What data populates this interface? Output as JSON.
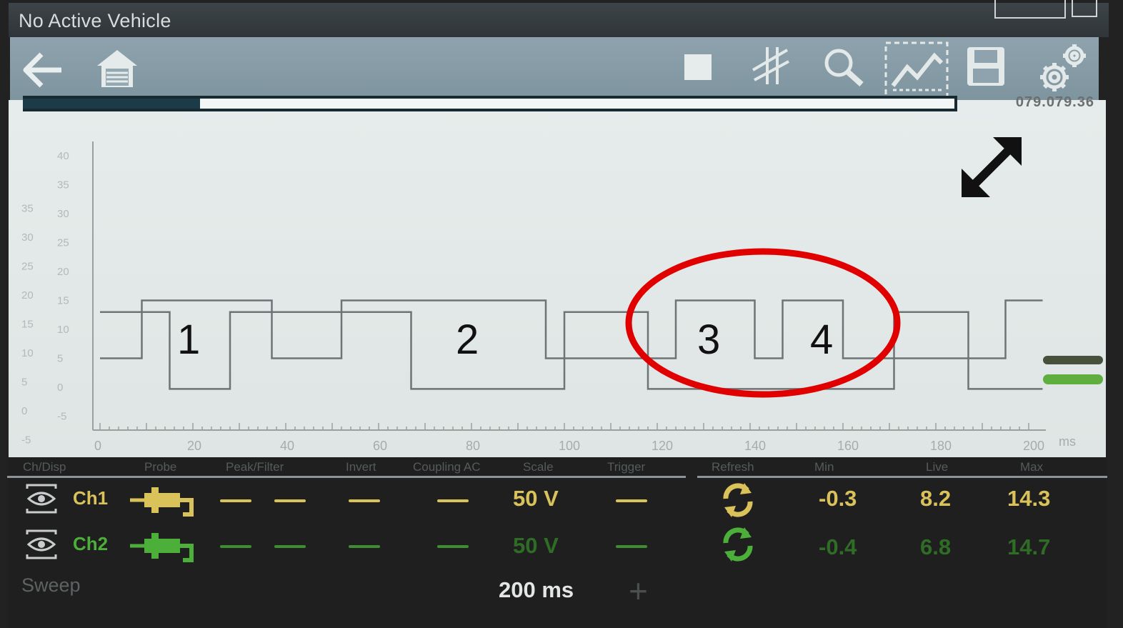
{
  "title_bar": {
    "title": "No Active Vehicle"
  },
  "toolbar": {
    "icons": [
      "back-arrow-icon",
      "home-garage-icon",
      "stop-icon",
      "cursor-icon",
      "zoom-icon",
      "trace-display-icon",
      "save-icon",
      "settings-gear-icon"
    ]
  },
  "capture": {
    "buffer_progress": 0.19,
    "readout": "079.079.36"
  },
  "chart_data": {
    "type": "line",
    "x_unit": "ms",
    "x": [
      0,
      20,
      40,
      60,
      80,
      100,
      120,
      140,
      160,
      180,
      200
    ],
    "xlim": [
      0,
      200
    ],
    "x_ticks": [
      "0",
      "20",
      "40",
      "60",
      "80",
      "100",
      "120",
      "140",
      "160",
      "180",
      "200"
    ],
    "y_ticks_ch1": [
      "-5",
      "0",
      "5",
      "10",
      "15",
      "20",
      "25",
      "30",
      "35",
      "40"
    ],
    "y_ticks_ch2": [
      "-5",
      "0",
      "5",
      "10",
      "15",
      "20",
      "25",
      "30",
      "35"
    ],
    "series": [
      {
        "name": "Ch1",
        "points": [
          [
            0,
            5
          ],
          [
            9,
            5
          ],
          [
            9,
            15
          ],
          [
            37,
            15
          ],
          [
            37,
            5
          ],
          [
            52,
            5
          ],
          [
            52,
            15
          ],
          [
            96,
            15
          ],
          [
            96,
            5
          ],
          [
            124,
            5
          ],
          [
            124,
            15
          ],
          [
            141,
            15
          ],
          [
            141,
            5
          ],
          [
            147,
            5
          ],
          [
            147,
            15
          ],
          [
            160,
            15
          ],
          [
            160,
            5
          ],
          [
            195,
            5
          ],
          [
            195,
            15
          ],
          [
            203,
            15
          ]
        ]
      },
      {
        "name": "Ch2",
        "points": [
          [
            0,
            13
          ],
          [
            15,
            13
          ],
          [
            15,
            -0.3
          ],
          [
            28,
            -0.3
          ],
          [
            28,
            13
          ],
          [
            67,
            13
          ],
          [
            67,
            -0.3
          ],
          [
            100,
            -0.3
          ],
          [
            100,
            13
          ],
          [
            118,
            13
          ],
          [
            118,
            -0.3
          ],
          [
            171,
            -0.3
          ],
          [
            171,
            13
          ],
          [
            187,
            13
          ],
          [
            187,
            -0.3
          ],
          [
            203,
            -0.3
          ]
        ]
      }
    ],
    "annotations": [
      "1",
      "2",
      "3",
      "4"
    ]
  },
  "columns": [
    "Ch/Disp",
    "Probe",
    "Peak/Filter",
    "Invert",
    "Coupling AC",
    "Scale",
    "Trigger",
    "Refresh",
    "Min",
    "Live",
    "Max"
  ],
  "channels": [
    {
      "name": "Ch1",
      "peak": "-----",
      "filter": "-----",
      "invert": "------",
      "coupling": "------",
      "scale": "50 V",
      "trigger": "-----",
      "min": "-0.3",
      "live": "8.2",
      "max": "14.3",
      "color": "#d9c25a"
    },
    {
      "name": "Ch2",
      "peak": "-----",
      "filter": "-----",
      "invert": "------",
      "coupling": "------",
      "scale": "50 V",
      "trigger": "-----",
      "min": "-0.4",
      "live": "6.8",
      "max": "14.7",
      "color": "#4caf3a"
    }
  ],
  "sweep": {
    "label": "Sweep",
    "value": "200 ms",
    "plus": "+"
  },
  "colors": {
    "toolbar": "#8ea3ad",
    "graph_bg": "#e3e9e8",
    "trace": "#6d7476",
    "annotation_ring": "#e00000",
    "ch1": "#d9c25a",
    "ch2": "#4caf3a"
  }
}
